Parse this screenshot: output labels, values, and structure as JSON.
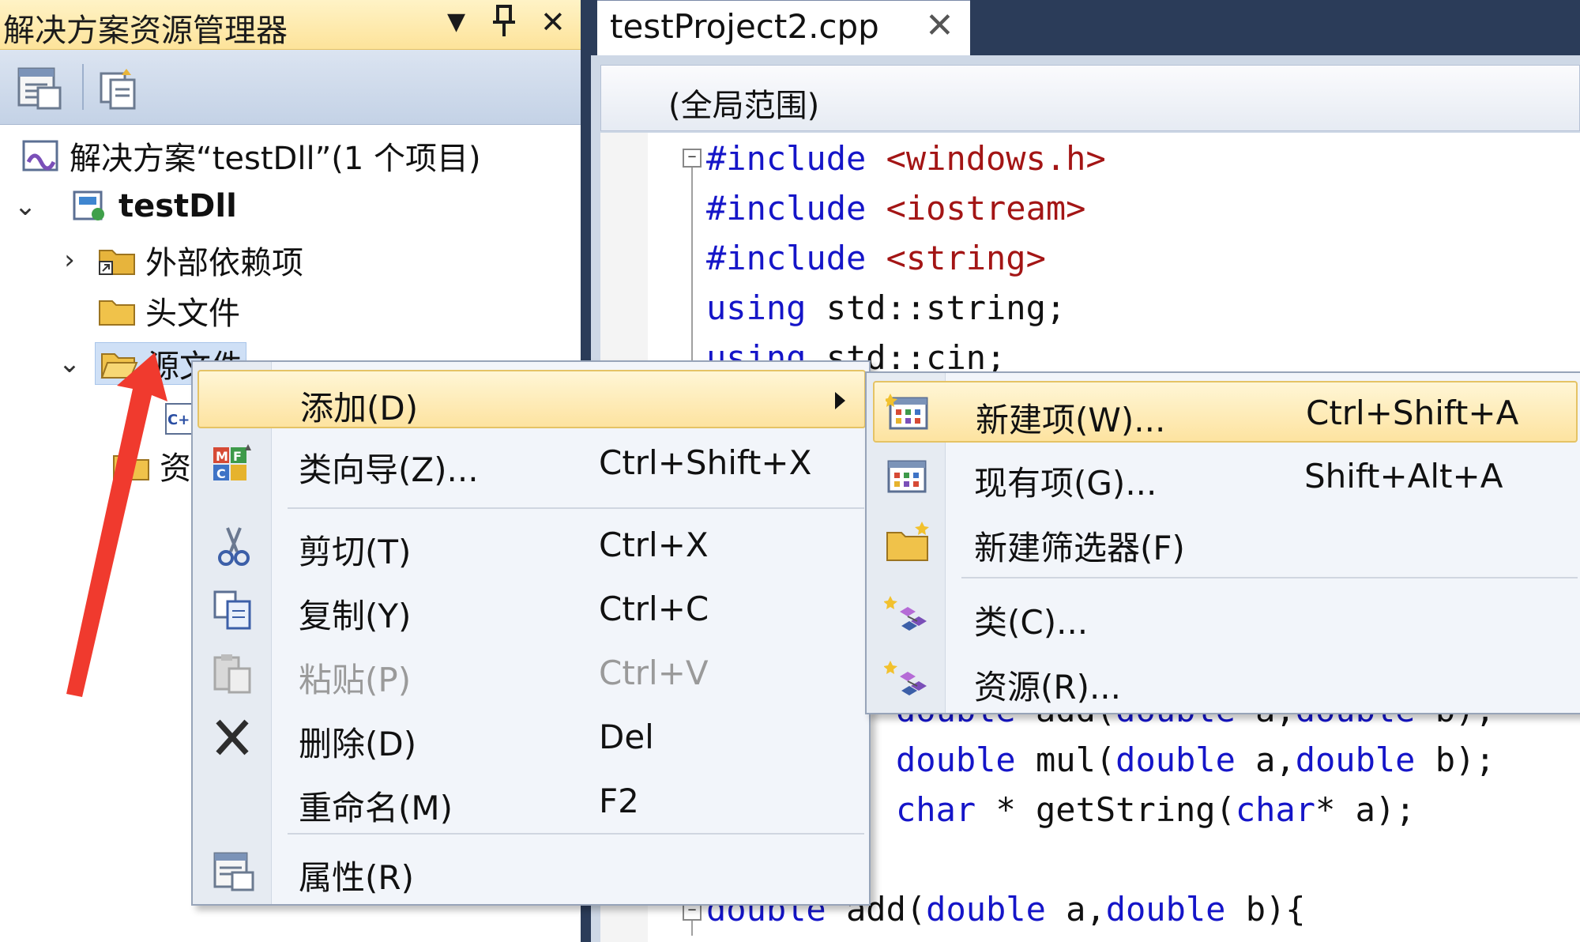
{
  "explorer": {
    "title": "解决方案资源管理器",
    "controls": {
      "dropdown": "▼",
      "pin": "⊓",
      "close": "✕"
    },
    "toolbar": {
      "buttons": [
        "properties-icon",
        "show-all-files-icon"
      ]
    },
    "tree": {
      "solution": "解决方案“testDll”(1 个项目)",
      "project": "testDll",
      "external_deps": "外部依赖项",
      "headers": "头文件",
      "sources": "源文件",
      "resources": "资"
    }
  },
  "editor": {
    "tab": {
      "label": "testProject2.cpp",
      "close": "✕"
    },
    "scope": "(全局范围)",
    "lines": {
      "l1_kw": "#include",
      "l1_str": " <windows.h>",
      "l2_kw": "#include",
      "l2_str": " <iostream>",
      "l3_kw": "#include",
      "l3_str": " <string>",
      "l4_kw": "using",
      "l4_rest": " std::string;",
      "l5_kw": "using",
      "l5_rest": " std::cin;",
      "l6_a": "double",
      "l6_b": " add(",
      "l6_c": "double",
      "l6_d": " a,",
      "l6_e": "double",
      "l6_f": " b);",
      "l7_a": "double",
      "l7_b": " mul(",
      "l7_c": "double",
      "l7_d": " a,",
      "l7_e": "double",
      "l7_f": " b);",
      "l8_a": "char",
      "l8_b": " * getString(",
      "l8_c": "char",
      "l8_d": "* a);",
      "l9_a": "double",
      "l9_b": " add(",
      "l9_c": "double",
      "l9_d": " a,",
      "l9_e": "double",
      "l9_f": " b){"
    },
    "fold_minus": "−"
  },
  "context_menu": {
    "items": [
      {
        "label": "添加(D)",
        "shortcut": ""
      },
      {
        "label": "类向导(Z)...",
        "shortcut": "Ctrl+Shift+X"
      },
      {
        "label": "剪切(T)",
        "shortcut": "Ctrl+X"
      },
      {
        "label": "复制(Y)",
        "shortcut": "Ctrl+C"
      },
      {
        "label": "粘贴(P)",
        "shortcut": "Ctrl+V"
      },
      {
        "label": "删除(D)",
        "shortcut": "Del"
      },
      {
        "label": "重命名(M)",
        "shortcut": "F2"
      },
      {
        "label": "属性(R)",
        "shortcut": ""
      }
    ]
  },
  "submenu": {
    "items": [
      {
        "label": "新建项(W)...",
        "shortcut": "Ctrl+Shift+A"
      },
      {
        "label": "现有项(G)...",
        "shortcut": "Shift+Alt+A"
      },
      {
        "label": "新建筛选器(F)",
        "shortcut": ""
      },
      {
        "label": "类(C)...",
        "shortcut": ""
      },
      {
        "label": "资源(R)...",
        "shortcut": ""
      }
    ]
  },
  "colors": {
    "keyword": "#1515c8",
    "string": "#a31515",
    "highlight": "#fde3a0",
    "arrow": "#f03a2e"
  }
}
